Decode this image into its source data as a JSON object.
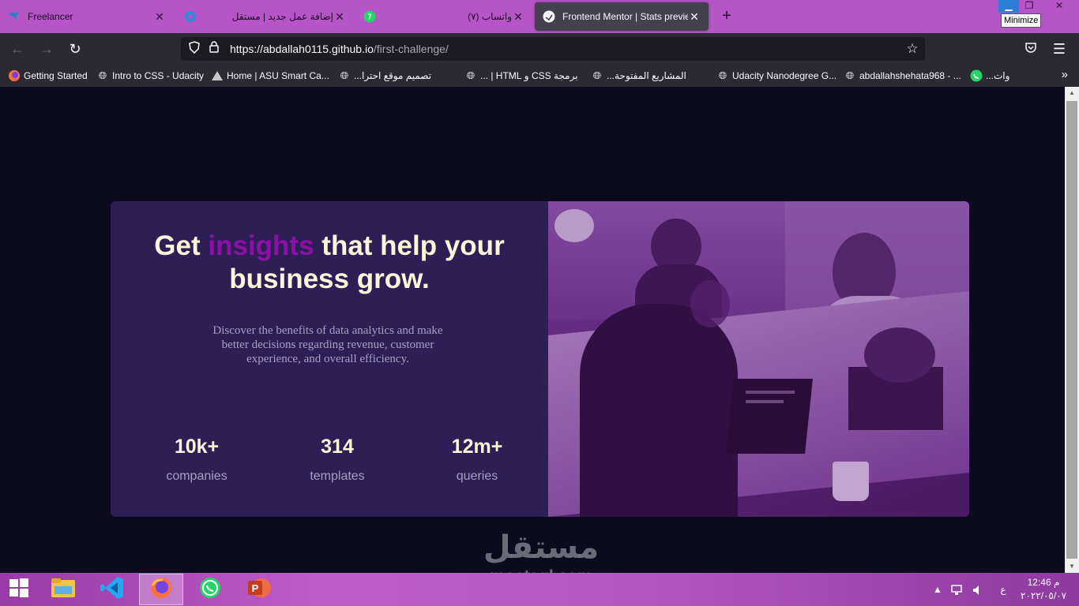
{
  "browser": {
    "tabs": [
      {
        "title": "Freelancer",
        "icon": "freelancer-logo-icon",
        "active": false
      },
      {
        "title": "إضافة عمل جديد | مستقل",
        "icon": "mostaql-icon",
        "active": false
      },
      {
        "title": "واتساب (٧)",
        "icon": "whatsapp-icon",
        "badge": "7",
        "active": false
      },
      {
        "title": "Frontend Mentor | Stats preview",
        "icon": "frontend-mentor-icon",
        "active": true
      }
    ],
    "new_tab_label": "+",
    "window": {
      "minimize_tooltip": "Minimize"
    },
    "url": {
      "host": "https://abdallah0115.github.io",
      "path": "/first-challenge/"
    },
    "bookmarks": [
      {
        "label": "Getting Started",
        "icon": "firefox-icon"
      },
      {
        "label": "Intro to CSS - Udacity",
        "icon": "globe-icon"
      },
      {
        "label": "Home | ASU Smart Ca...",
        "icon": "asu-logo-icon"
      },
      {
        "label": "تصميم موقع احترا...",
        "icon": "globe-icon"
      },
      {
        "label": "برمجة CSS و HTML | ...",
        "icon": "globe-icon"
      },
      {
        "label": "المشاريع المفتوحة...",
        "icon": "globe-icon"
      },
      {
        "label": "Udacity Nanodegree G...",
        "icon": "globe-icon"
      },
      {
        "label": "abdallahshehata968 - ...",
        "icon": "globe-icon"
      },
      {
        "label": "وات...",
        "icon": "whatsapp-icon"
      }
    ]
  },
  "page": {
    "headline": {
      "pre": "Get ",
      "accent": "insights",
      "post": " that help your business grow."
    },
    "description": "Discover the benefits of data analytics and make better decisions regarding revenue, customer experience, and overall efficiency.",
    "stats": [
      {
        "value": "10k+",
        "label": "companies"
      },
      {
        "value": "314",
        "label": "templates"
      },
      {
        "value": "12m+",
        "label": "queries"
      }
    ],
    "colors": {
      "background": "#0b0a1e",
      "card": "#2d1f55",
      "accent": "#8e0fa6",
      "heading": "#fdf5d9",
      "text": "#a89fbf"
    }
  },
  "watermark": {
    "arabic": "مستقل",
    "latin": "mostaql.com"
  },
  "taskbar": {
    "apps": [
      "file-explorer-icon",
      "vscode-icon",
      "firefox-icon",
      "whatsapp-icon",
      "powerpoint-icon"
    ],
    "language": "ع",
    "clock": {
      "time": "12:46 م",
      "date": "٢٠٢٢/٠٥/٠٧"
    }
  }
}
